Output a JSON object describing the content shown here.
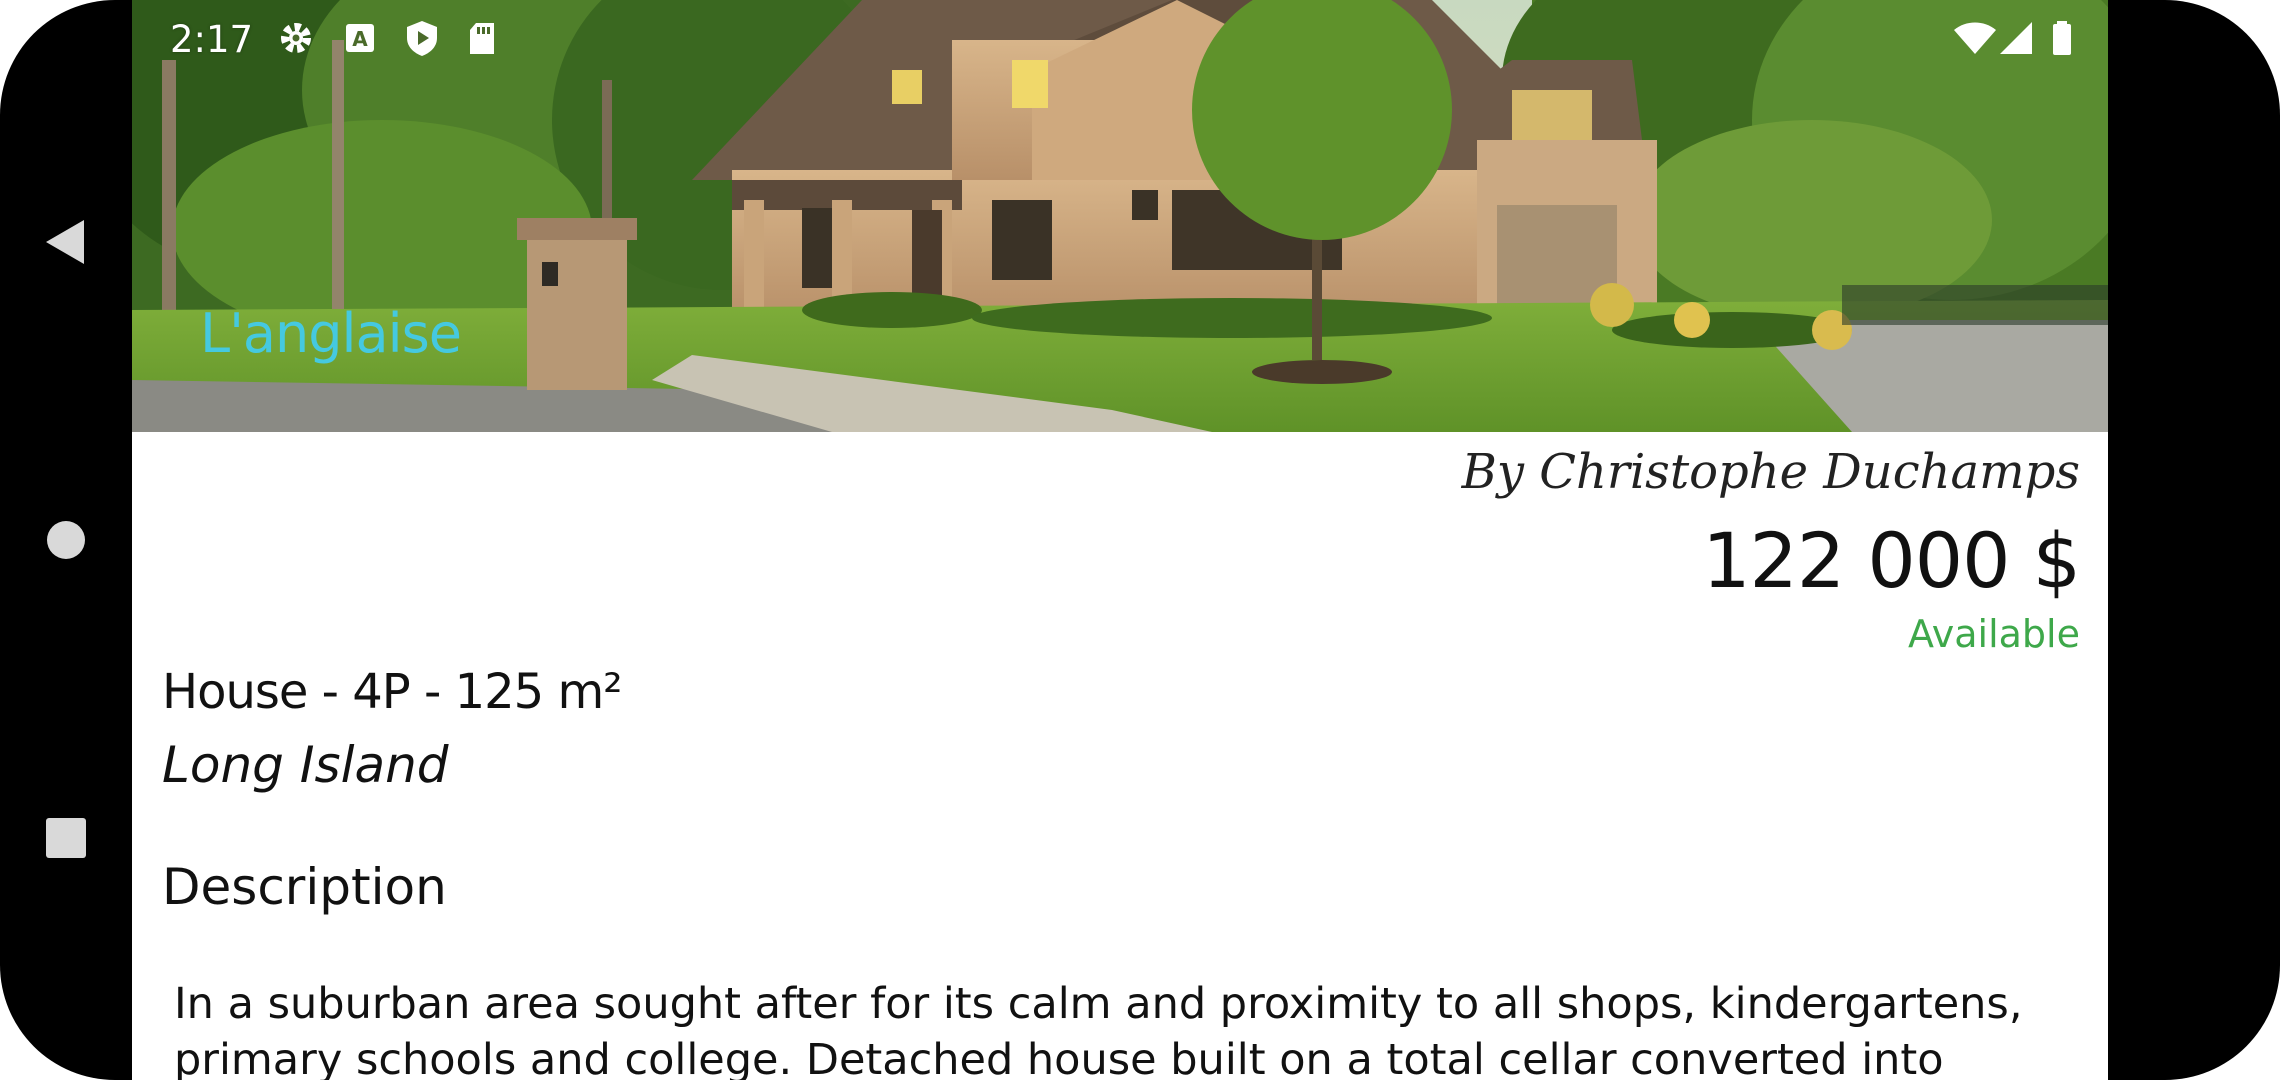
{
  "status_bar": {
    "time": "2:17",
    "icons": [
      "settings-icon",
      "keyboard-a-icon",
      "play-protect-icon",
      "sd-card-icon",
      "wifi-icon",
      "signal-icon",
      "battery-icon"
    ]
  },
  "navigation": {
    "buttons": [
      "back",
      "home",
      "recents"
    ]
  },
  "listing": {
    "name": "L'anglaise",
    "author": "By Christophe Duchamps",
    "price": "122 000 $",
    "status": "Available",
    "type_line": "House - 4P - 125 m²",
    "location": "Long Island",
    "description_heading": "Description",
    "description": "In a suburban area sought after for its calm and proximity to all shops, kindergartens, primary schools and college. Detached house built on a total cellar converted into"
  },
  "colors": {
    "title_accent": "#45c9e0",
    "available": "#3ea84a",
    "text": "#111111",
    "frame": "#000000"
  }
}
